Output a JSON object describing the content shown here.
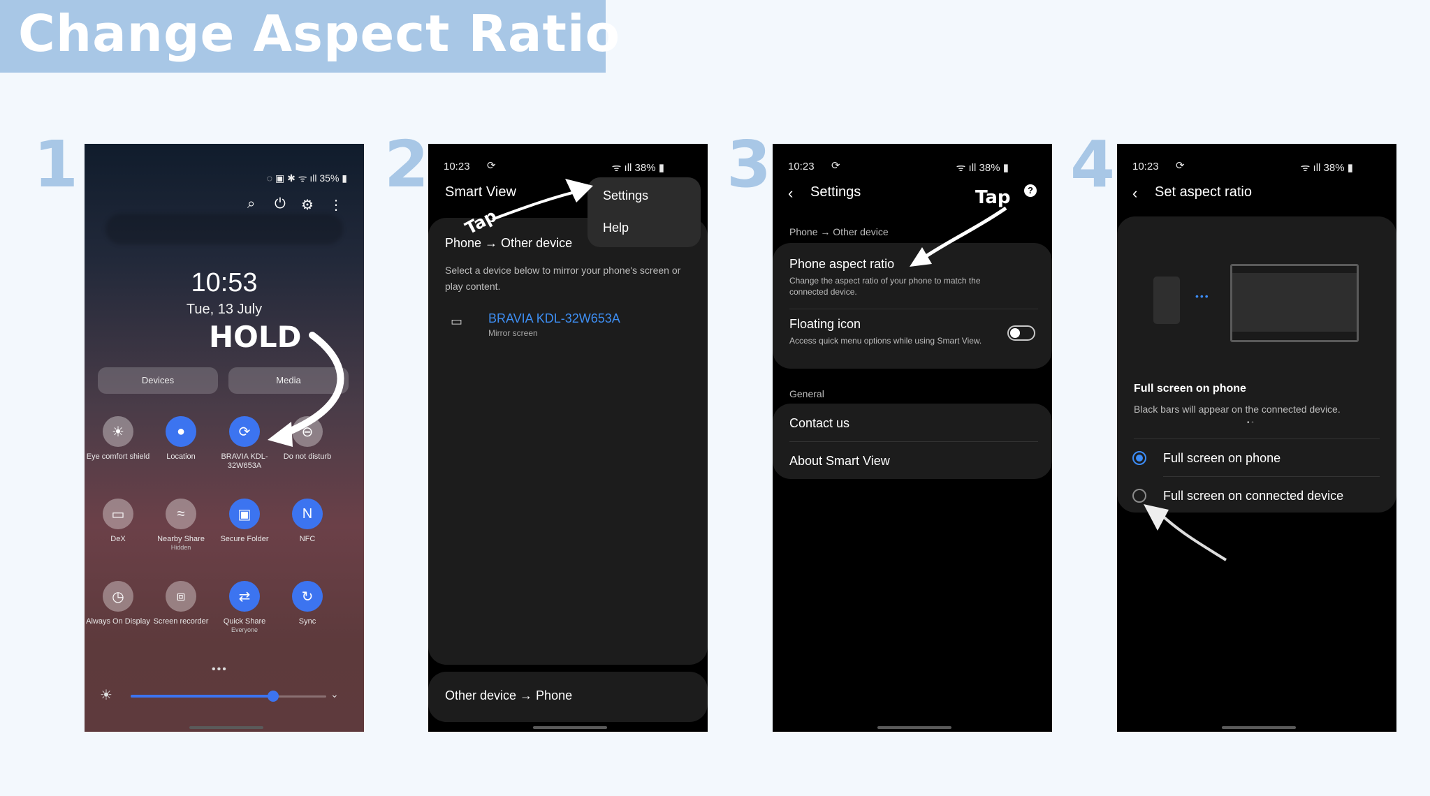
{
  "title": "Change Aspect Ratio",
  "steps": [
    "1",
    "2",
    "3",
    "4"
  ],
  "phone1": {
    "status_right": "35%",
    "clock": "10:53",
    "date": "Tue, 13 July",
    "annotation": "HOLD",
    "tabs": [
      "Devices",
      "Media"
    ],
    "tiles": [
      {
        "label": "Eye comfort shield",
        "sub": "",
        "icon": "eye-comfort-icon",
        "on": false
      },
      {
        "label": "Location",
        "sub": "",
        "icon": "location-pin-icon",
        "on": true
      },
      {
        "label": "BRAVIA KDL-32W653A",
        "sub": "",
        "icon": "smart-view-icon",
        "on": true
      },
      {
        "label": "Do not disturb",
        "sub": "",
        "icon": "do-not-disturb-icon",
        "on": false
      },
      {
        "label": "DeX",
        "sub": "",
        "icon": "dex-icon",
        "on": false
      },
      {
        "label": "Nearby Share",
        "sub": "Hidden",
        "icon": "nearby-share-icon",
        "on": false
      },
      {
        "label": "Secure Folder",
        "sub": "",
        "icon": "secure-folder-icon",
        "on": true
      },
      {
        "label": "NFC",
        "sub": "",
        "icon": "nfc-icon",
        "on": true
      },
      {
        "label": "Always On Display",
        "sub": "",
        "icon": "always-on-display-icon",
        "on": false
      },
      {
        "label": "Screen recorder",
        "sub": "",
        "icon": "screen-recorder-icon",
        "on": false
      },
      {
        "label": "Quick Share",
        "sub": "Everyone",
        "icon": "quick-share-icon",
        "on": true
      },
      {
        "label": "Sync",
        "sub": "",
        "icon": "sync-icon",
        "on": true
      }
    ],
    "brightness": 0.73
  },
  "status": {
    "time": "10:23",
    "battery": "38%"
  },
  "phone2": {
    "title": "Smart View",
    "menu": [
      "Settings",
      "Help"
    ],
    "annotation": "Tap",
    "section_title": "Phone → Other device",
    "description": "Select a device below to mirror your phone's screen or play content.",
    "device_name": "BRAVIA KDL-32W653A",
    "device_sub": "Mirror screen",
    "bottom_section": "Other device → Phone"
  },
  "phone3": {
    "title": "Settings",
    "annotation": "Tap",
    "section1": "Phone → Other device",
    "item1_title": "Phone aspect ratio",
    "item1_desc": "Change the aspect ratio of your phone to match the connected device.",
    "item2_title": "Floating icon",
    "item2_desc": "Access quick menu options while using Smart View.",
    "section2": "General",
    "item3": "Contact us",
    "item4": "About Smart View"
  },
  "phone4": {
    "title": "Set aspect ratio",
    "preview_title": "Full screen on phone",
    "preview_desc": "Black bars will appear on the connected device.",
    "option1": "Full screen on phone",
    "option2": "Full screen on connected device",
    "selected": 0
  },
  "colors": {
    "accent": "#3c74f0",
    "banner": "#a8c7e6",
    "link": "#3e8ef2"
  }
}
